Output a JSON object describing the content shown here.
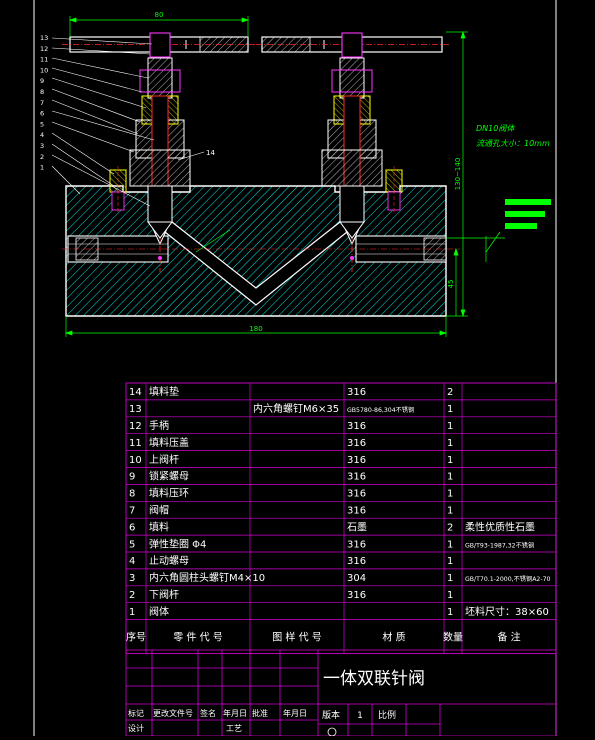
{
  "drawing": {
    "dim_width_top": "80",
    "dim_total_width": "180",
    "dim_height": "130~140",
    "dim_lower_height": "45",
    "callout_14": "14",
    "pipe_note_line1": "DN10阀体",
    "pipe_note_line2": "流通孔大小：10mm",
    "part_numbers_left": [
      "13",
      "12",
      "11",
      "10",
      "9",
      "8",
      "7",
      "6",
      "5",
      "4",
      "3",
      "2",
      "1"
    ]
  },
  "bom": {
    "rows": [
      {
        "no": "14",
        "name": "填料垫",
        "std": "",
        "material": "316",
        "qty": "2",
        "note": ""
      },
      {
        "no": "13",
        "name": "",
        "std": "内六角螺钉M6×35",
        "material": "GB5780-86,304不锈钢",
        "qty": "1",
        "note": ""
      },
      {
        "no": "12",
        "name": "手柄",
        "std": "",
        "material": "316",
        "qty": "1",
        "note": ""
      },
      {
        "no": "11",
        "name": "填料压盖",
        "std": "",
        "material": "316",
        "qty": "1",
        "note": ""
      },
      {
        "no": "10",
        "name": "上阀杆",
        "std": "",
        "material": "316",
        "qty": "1",
        "note": ""
      },
      {
        "no": "9",
        "name": "锁紧螺母",
        "std": "",
        "material": "316",
        "qty": "1",
        "note": ""
      },
      {
        "no": "8",
        "name": "填料压环",
        "std": "",
        "material": "316",
        "qty": "1",
        "note": ""
      },
      {
        "no": "7",
        "name": "阀帽",
        "std": "",
        "material": "316",
        "qty": "1",
        "note": ""
      },
      {
        "no": "6",
        "name": "填料",
        "std": "",
        "material": "石墨",
        "qty": "2",
        "note": "柔性优质性石墨"
      },
      {
        "no": "5",
        "name": "弹性垫圈 Φ4",
        "std": "",
        "material": "316",
        "qty": "1",
        "note": "GB/T93-1987,32不锈钢"
      },
      {
        "no": "4",
        "name": "止动螺母",
        "std": "",
        "material": "316",
        "qty": "1",
        "note": ""
      },
      {
        "no": "3",
        "name": "内六角圆柱头螺钉M4×10",
        "std": "",
        "material": "304",
        "qty": "1",
        "note": "GB/T70.1-2000,不锈钢A2-70"
      },
      {
        "no": "2",
        "name": "下阀杆",
        "std": "",
        "material": "316",
        "qty": "1",
        "note": ""
      },
      {
        "no": "1",
        "name": "阀体",
        "std": "",
        "material": "",
        "qty": "1",
        "note": "坯料尺寸：38×60"
      }
    ],
    "header": {
      "no": "序号",
      "name": "零 件 代 号",
      "std": "图 样 代 号",
      "material": "材 质",
      "qty": "数量",
      "note": "备 注"
    }
  },
  "title_block": {
    "title": "一体双联针阀",
    "label_mark": "标记",
    "label_change": "更改文件号",
    "label_sign": "签名",
    "label_date": "年月日",
    "label_approve": "批准",
    "label_date2": "年月日",
    "label_design": "设计",
    "label_process": "工艺",
    "label_version": "版本",
    "version": "1",
    "label_scale": "比例"
  },
  "colors": {
    "background": "#000000",
    "outline": "#ffffff",
    "hatch": "#00ffff",
    "dimension": "#00ff00",
    "part_red": "#ff2a2a",
    "part_magenta": "#ff33ff",
    "yellow": "#ffff00",
    "table_line": "#d400d4",
    "table_text": "#ffffff"
  }
}
